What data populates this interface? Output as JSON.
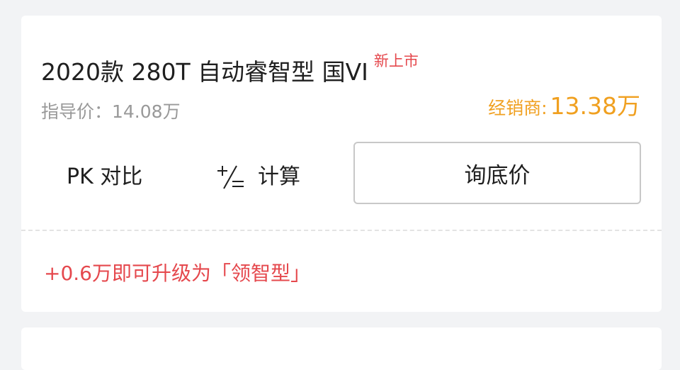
{
  "model": {
    "name": "2020款 280T 自动睿智型 国VI",
    "badge": "新上市"
  },
  "price": {
    "guide_text": "指导价：14.08万",
    "dealer_label": "经销商:",
    "dealer_value": "13.38万"
  },
  "actions": {
    "pk_label": "PK 对比",
    "calc_label": "计算",
    "calc_icon": "plus-minus-equals-icon",
    "inquiry_label": "询底价"
  },
  "upgrade": {
    "text": "+0.6万即可升级为「领智型」"
  },
  "colors": {
    "badge": "#e5484d",
    "dealer_price": "#f0a020",
    "upgrade_text": "#e5484d",
    "muted_text": "#999999",
    "primary_text": "#1f1f1f",
    "background": "#f2f3f5",
    "card": "#ffffff"
  }
}
